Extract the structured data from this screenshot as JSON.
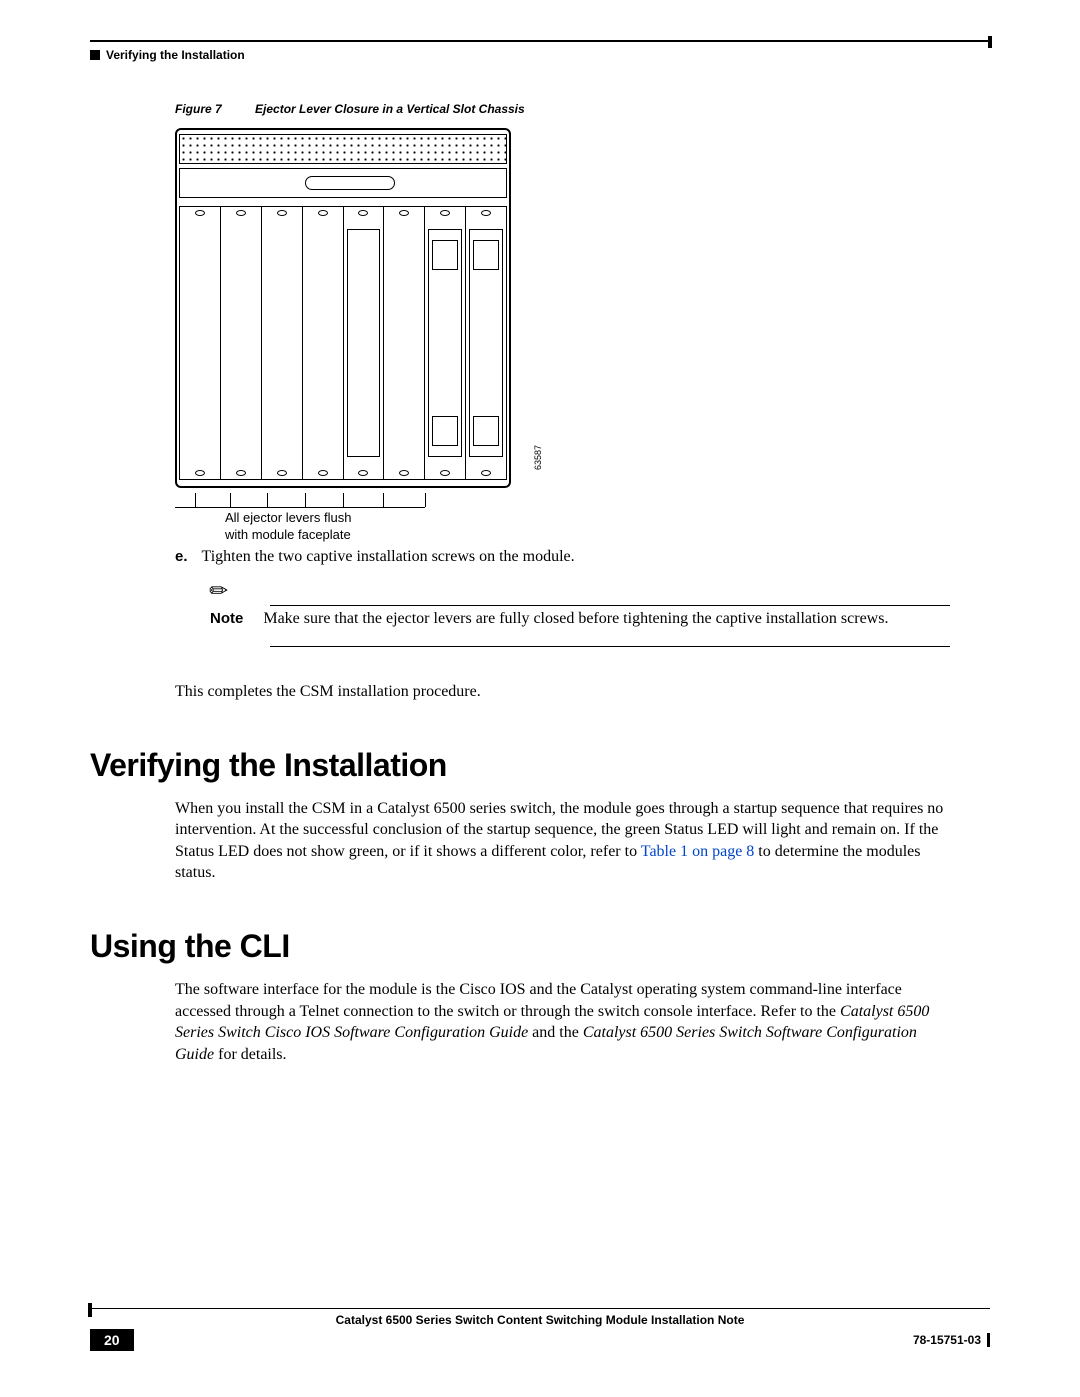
{
  "header": {
    "running_title": "Verifying the Installation"
  },
  "figure": {
    "label": "Figure 7",
    "title": "Ejector Lever Closure in a Vertical Slot Chassis",
    "ref_num": "63587",
    "callout_line1": "All ejector levers flush",
    "callout_line2": "with module faceplate"
  },
  "step": {
    "letter": "e.",
    "text": "Tighten the two captive installation screws on the module."
  },
  "note": {
    "label": "Note",
    "text": "Make sure that the ejector levers are fully closed before tightening the captive installation screws."
  },
  "para1": "This completes the CSM installation procedure.",
  "section1": {
    "heading": "Verifying the Installation",
    "text_a": "When you install the CSM in a Catalyst 6500 series switch, the module goes through a startup sequence that requires no intervention. At the successful conclusion of the startup sequence, the green Status LED will light and remain on. If the Status LED does not show green, or if it shows a different color, refer to ",
    "link": "Table 1 on page 8",
    "text_b": " to determine the modules status."
  },
  "section2": {
    "heading": "Using the CLI",
    "text_a": "The software interface for the module is the Cisco IOS and the Catalyst operating system command-line interface accessed through a Telnet connection to the switch or through the switch console interface. Refer to the ",
    "em1": "Catalyst 6500 Series Switch Cisco IOS Software Configuration Guide",
    "mid": " and the ",
    "em2": "Catalyst 6500 Series Switch Software Configuration Guide",
    "text_b": " for details."
  },
  "footer": {
    "doc_title": "Catalyst 6500 Series Switch Content Switching Module Installation Note",
    "page": "20",
    "docnum": "78-15751-03"
  }
}
